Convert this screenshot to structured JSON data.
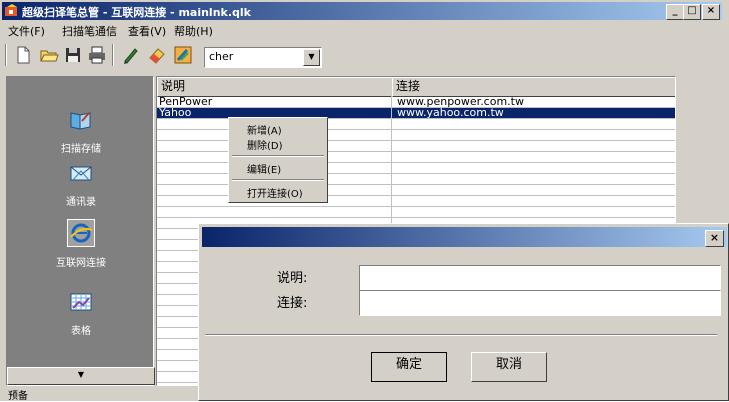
{
  "window": {
    "title": "超级扫译笔总管 - 互联网连接 - mainlnk.qlk",
    "minimize": "_",
    "maximize": "□",
    "close": "×"
  },
  "menubar": [
    "文件(F)",
    "扫描笔通信",
    "查看(V)",
    "帮助(H)"
  ],
  "toolbar": {
    "combo_value": "cher",
    "icons": [
      "new-file-icon",
      "open-folder-icon",
      "save-icon",
      "print-icon",
      "pen-icon",
      "eraser-icon",
      "highlighter-icon"
    ]
  },
  "sidebar": {
    "items": [
      {
        "label": "扫描存储",
        "icon": "scan-storage-icon"
      },
      {
        "label": "通讯录",
        "icon": "address-book-icon"
      },
      {
        "label": "互联网连接",
        "icon": "internet-icon"
      },
      {
        "label": "表格",
        "icon": "table-icon"
      }
    ]
  },
  "grid": {
    "columns": [
      "说明",
      "连接"
    ],
    "rows": [
      [
        "PenPower",
        "www.penpower.com.tw"
      ],
      [
        "Yahoo",
        "www.yahoo.com.tw"
      ]
    ],
    "selected_row": 1
  },
  "context_menu": {
    "items": [
      "新增(A)",
      "删除(D)",
      "编辑(E)",
      "打开连接(O)"
    ]
  },
  "dialog": {
    "close": "×",
    "label_desc": "说明:",
    "label_link": "连接:",
    "desc_value": "",
    "link_value": "",
    "ok": "确定",
    "cancel": "取消"
  },
  "status": "预备",
  "colors": {
    "face": "#d4d0c8",
    "title_start": "#0a246a",
    "title_end": "#a6caf0",
    "selection": "#0a246a",
    "sidebar": "#808080"
  }
}
